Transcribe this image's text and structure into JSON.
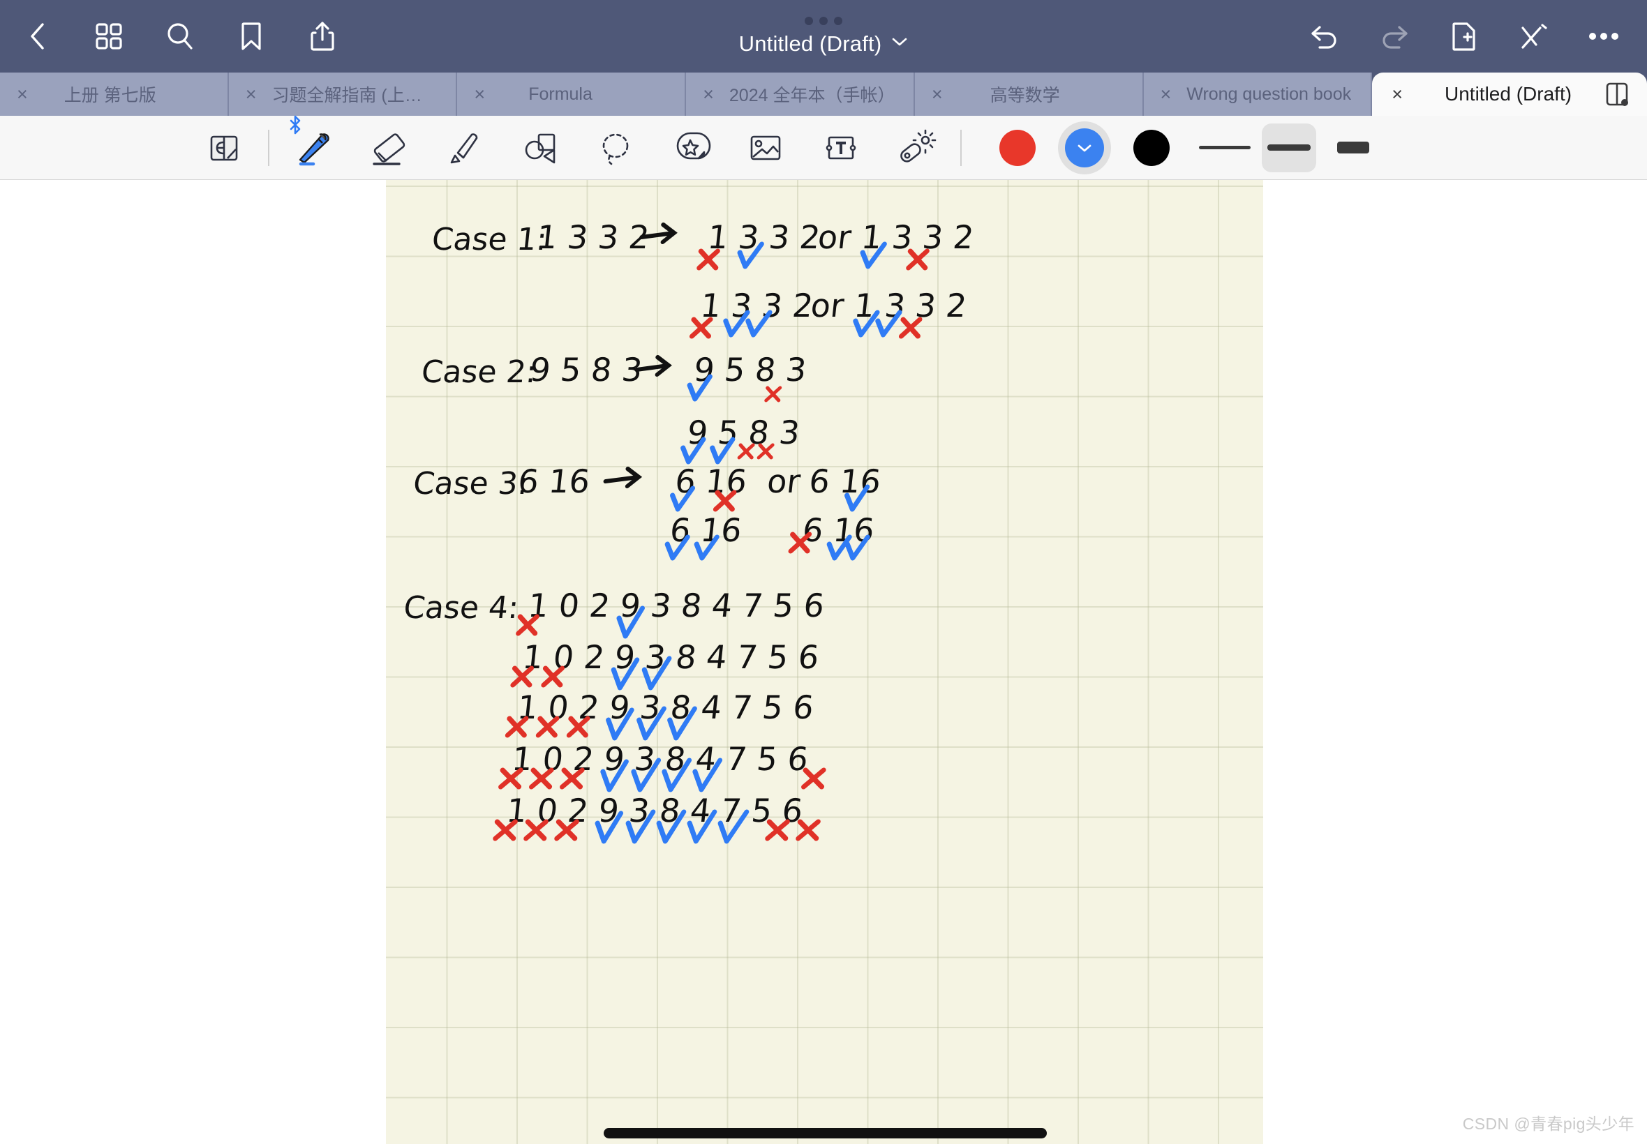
{
  "app": {
    "title": "Untitled (Draft)",
    "title_chevron": "chevron-down"
  },
  "topbar": {
    "left_icons": [
      {
        "name": "back-icon",
        "label": "Back"
      },
      {
        "name": "grid-icon",
        "label": "Page grid"
      },
      {
        "name": "search-icon",
        "label": "Search"
      },
      {
        "name": "bookmark-icon",
        "label": "Bookmark"
      },
      {
        "name": "share-icon",
        "label": "Share"
      }
    ],
    "right_icons": [
      {
        "name": "undo-icon",
        "label": "Undo"
      },
      {
        "name": "redo-icon",
        "label": "Redo"
      },
      {
        "name": "new-page-icon",
        "label": "New page"
      },
      {
        "name": "close-pen-icon",
        "label": "Close pen"
      },
      {
        "name": "more-icon",
        "label": "More"
      }
    ]
  },
  "tabs": [
    {
      "label": "上册 第七版",
      "close": "×",
      "active": false
    },
    {
      "label": "习题全解指南 (上册…",
      "close": "×",
      "active": false
    },
    {
      "label": "Formula",
      "close": "×",
      "active": false
    },
    {
      "label": "2024 全年本（手帐）",
      "close": "×",
      "active": false
    },
    {
      "label": "高等数学",
      "close": "×",
      "active": false
    },
    {
      "label": "Wrong question book",
      "close": "×",
      "active": false
    },
    {
      "label": "Untitled (Draft)",
      "close": "×",
      "active": true,
      "split_icon": "split-view-icon"
    }
  ],
  "toolbar": {
    "tools": [
      {
        "name": "page-flip-tool",
        "label": "Page flip",
        "selected": false
      },
      {
        "name": "pen-tool",
        "label": "Pen",
        "selected": true,
        "badge": "bluetooth-icon"
      },
      {
        "name": "eraser-tool",
        "label": "Eraser",
        "selected": false
      },
      {
        "name": "highlighter-tool",
        "label": "Highlighter",
        "selected": false
      },
      {
        "name": "shapes-tool",
        "label": "Shapes",
        "selected": false
      },
      {
        "name": "lasso-tool",
        "label": "Lasso",
        "selected": false
      },
      {
        "name": "sticker-tool",
        "label": "Sticker",
        "selected": false
      },
      {
        "name": "image-tool",
        "label": "Image",
        "selected": false
      },
      {
        "name": "text-tool",
        "label": "Text",
        "selected": false
      },
      {
        "name": "laser-tool",
        "label": "Laser pointer",
        "selected": false
      }
    ],
    "colors": [
      {
        "name": "color-red",
        "hex": "#e8372a",
        "selected": false
      },
      {
        "name": "color-blue",
        "hex": "#3b82f0",
        "selected": true
      },
      {
        "name": "color-black",
        "hex": "#000000",
        "selected": false
      }
    ],
    "widths": [
      {
        "name": "width-thin",
        "px": 5,
        "len": 74,
        "selected": false
      },
      {
        "name": "width-medium",
        "px": 9,
        "len": 62,
        "selected": true
      },
      {
        "name": "width-thick",
        "px": 17,
        "len": 46,
        "selected": false
      }
    ]
  },
  "notes": {
    "cases": [
      {
        "label": "Case 1:",
        "source": "1 3 3 2",
        "arrow": "→",
        "lines": [
          {
            "items": [
              "1",
              "3",
              "3",
              "2"
            ],
            "marks": [
              "x",
              "check",
              "",
              ""
            ],
            "or": "or",
            "alt_items": [
              "1",
              "3",
              "3",
              "2"
            ],
            "alt_marks": [
              "check",
              "",
              "",
              "x"
            ]
          },
          {
            "items": [
              "1",
              "3",
              "3",
              "2"
            ],
            "marks": [
              "x",
              "check",
              "check",
              ""
            ],
            "or": "or",
            "alt_items": [
              "1",
              "3",
              "3",
              "2"
            ],
            "alt_marks": [
              "check",
              "check",
              "",
              "x"
            ]
          }
        ]
      },
      {
        "label": "Case 2:",
        "source": "9 5 8 3",
        "arrow": "→",
        "lines": [
          {
            "items": [
              "9",
              "5",
              "8",
              "3"
            ],
            "marks": [
              "check",
              "",
              "",
              "x"
            ]
          },
          {
            "items": [
              "9",
              "5",
              "8",
              "3"
            ],
            "marks": [
              "check",
              "check",
              "x",
              "x"
            ]
          }
        ]
      },
      {
        "label": "Case 3:",
        "source": "6 16",
        "arrow": "→",
        "lines": [
          {
            "items": [
              "6",
              "16"
            ],
            "marks": [
              "check",
              "x"
            ],
            "or": "or",
            "alt_items": [
              "6",
              "16"
            ],
            "alt_marks": [
              "",
              "check"
            ]
          },
          {
            "items": [
              "6",
              "16"
            ],
            "marks": [
              "check",
              "check"
            ],
            "alt_items": [
              "6",
              "16"
            ],
            "alt_marks": [
              "x",
              "check-check"
            ]
          }
        ]
      },
      {
        "label": "Case 4:",
        "source": "1 0 2 9 3 8 4 7 5 6",
        "lines": [
          {
            "items": [
              "1",
              "0",
              "2",
              "9",
              "3",
              "8",
              "4",
              "7",
              "5",
              "6"
            ],
            "marks": [
              "x",
              "",
              "",
              "check",
              "",
              "",
              "",
              "",
              "",
              ""
            ]
          },
          {
            "items": [
              "1",
              "0",
              "2",
              "9",
              "3",
              "8",
              "4",
              "7",
              "5",
              "6"
            ],
            "marks": [
              "x",
              "x",
              "",
              "check",
              "check",
              "",
              "",
              "",
              "",
              ""
            ]
          },
          {
            "items": [
              "1",
              "0",
              "2",
              "9",
              "3",
              "8",
              "4",
              "7",
              "5",
              "6"
            ],
            "marks": [
              "x",
              "x",
              "x",
              "check",
              "check",
              "check",
              "",
              "",
              "",
              ""
            ]
          },
          {
            "items": [
              "1",
              "0",
              "2",
              "9",
              "3",
              "8",
              "4",
              "7",
              "5",
              "6"
            ],
            "marks": [
              "x",
              "x",
              "x",
              "check",
              "check",
              "check",
              "check",
              "",
              "",
              "x"
            ]
          },
          {
            "items": [
              "1",
              "0",
              "2",
              "9",
              "3",
              "8",
              "4",
              "7",
              "5",
              "6"
            ],
            "marks": [
              "x",
              "x",
              "x",
              "check",
              "check",
              "check",
              "check",
              "check",
              "x",
              "x"
            ]
          }
        ]
      }
    ],
    "ink_colors": {
      "pen": "#111111",
      "cross": "#e03127",
      "check": "#2f7bf5"
    }
  },
  "footer": {
    "watermark": "CSDN @青春pig头少年"
  }
}
